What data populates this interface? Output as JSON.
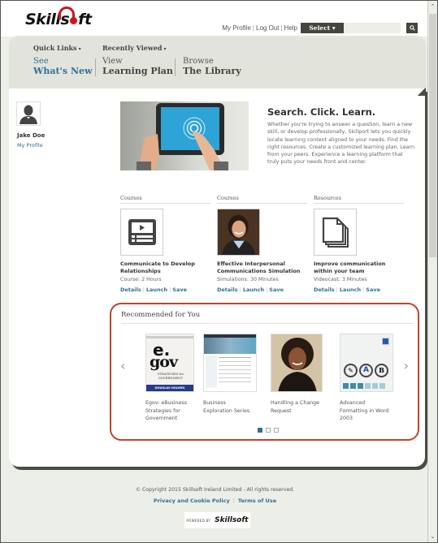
{
  "brand": {
    "logo_text_pre": "Skills",
    "logo_text_post": "ft",
    "accent_color": "#c8161d",
    "link_color": "#2f7196",
    "highlight_border_color": "#c0432e"
  },
  "utility": {
    "links": [
      "My Profile",
      "Log Out",
      "Help"
    ],
    "select_label": "Select ▾",
    "search_placeholder": "",
    "search_icon": "magnifier-icon"
  },
  "nav": {
    "quick_links": [
      {
        "label": "Quick Links",
        "caret": "▾"
      },
      {
        "label": "Recently Viewed",
        "caret": "▾"
      }
    ],
    "items": [
      {
        "small": "See",
        "big": "What's New",
        "active": true
      },
      {
        "small": "View",
        "big": "Learning Plan",
        "active": false
      },
      {
        "small": "Browse",
        "big": "The Library",
        "active": false
      }
    ]
  },
  "profile": {
    "name": "Jake Doe",
    "link": "My Profile",
    "avatar_icon": "user-silhouette-icon"
  },
  "hero": {
    "title": "Search. Click. Learn.",
    "text": "Whether you're trying to answer a question, learn a new skill, or develop professionally, Skillport lets you quickly locate learning content aligned to your needs. Find the right resources. Create a customized learning plan. Learn from your peers. Experience a learning platform that truly puts your needs front and center."
  },
  "cards": [
    {
      "category": "Courses",
      "title": "Communicate to Develop Relationships",
      "meta": "Course: 2 Hours",
      "thumb": "video-course-icon",
      "actions": [
        "Details",
        "Launch",
        "Save"
      ]
    },
    {
      "category": "Courses",
      "title": "Effective Interpersonal Communications Simulation",
      "meta": "Simulations: 30 Minutes",
      "thumb": "portrait-photo",
      "actions": [
        "Details",
        "Launch",
        "Save"
      ]
    },
    {
      "category": "Resources",
      "title": "Improve communication within your team",
      "meta": "Videocast: 3 Minutes",
      "thumb": "documents-stack-icon",
      "actions": [
        "Details",
        "Launch",
        "Save"
      ]
    }
  ],
  "recommended": {
    "heading": "Recommended for You",
    "prev_arrow": "‹",
    "next_arrow": "›",
    "items": [
      {
        "caption": "Egov: eBusiness Strategies for Government",
        "cover_top": "e.",
        "cover_mid": "gov",
        "cover_sub": "STRATEGIES for GOVERNMENT",
        "cover_author": "DOUGLAS HOLMES"
      },
      {
        "caption": "Business Exploration Series"
      },
      {
        "caption": "Handling a Change Request"
      },
      {
        "caption": "Advanced Formatting in Word 2003",
        "buttons": [
          "✎",
          "A",
          "B"
        ]
      }
    ],
    "pages": 3,
    "current_page": 1
  },
  "footer": {
    "copyright": "© Copyright 2015 Skillsoft Ireland Limited - All rights reserved.",
    "links": [
      "Privacy and Cookie Policy",
      "Terms of Use"
    ],
    "powered_by": "POWERED BY",
    "powered_logo": "Skillsoft"
  }
}
